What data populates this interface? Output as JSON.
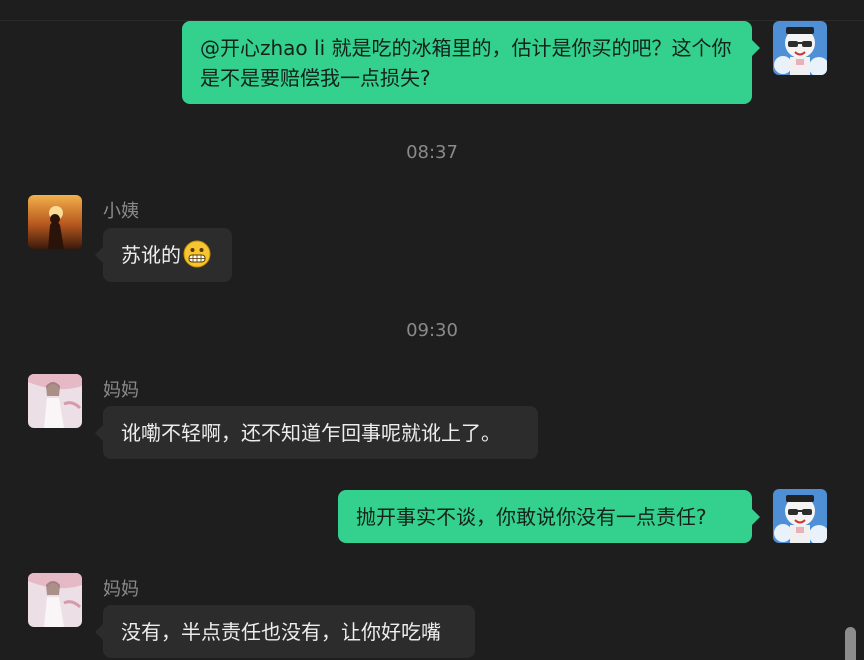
{
  "messages": [
    {
      "side": "out",
      "text": "@开心zhao li 就是吃的冰箱里的，估计是你买的吧？这个你是不是要赔偿我一点损失?"
    },
    {
      "type": "time",
      "text": "08:37"
    },
    {
      "side": "in",
      "sender": "小姨",
      "text": "苏讹的",
      "emoji": "grinning-face-icon"
    },
    {
      "type": "time",
      "text": "09:30"
    },
    {
      "side": "in",
      "sender": "妈妈",
      "text": "讹嘞不轻啊，还不知道乍回事呢就讹上了。"
    },
    {
      "side": "out",
      "text": "抛开事实不谈，你敢说你没有一点责任?"
    },
    {
      "side": "in",
      "sender": "妈妈",
      "text": "没有，半点责任也没有，让你好吃嘴"
    }
  ],
  "colors": {
    "background": "#1e1e1e",
    "incoming_bubble": "#2c2c2c",
    "outgoing_bubble": "#33d08e"
  }
}
